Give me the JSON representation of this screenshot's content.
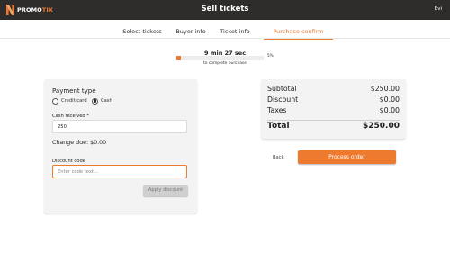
{
  "header": {
    "logo_text_left": "PROMO",
    "logo_text_right": "TIX",
    "title": "Sell tickets",
    "user": "Evi"
  },
  "tabs": [
    {
      "label": "Select tickets",
      "active": false
    },
    {
      "label": "Buyer info",
      "active": false
    },
    {
      "label": "Ticket info",
      "active": false
    },
    {
      "label": "Purchase confirm",
      "active": true
    }
  ],
  "timer": {
    "text": "9 min 27 sec",
    "progress_percent": 5,
    "progress_label": "5%",
    "caption": "to complete purchase"
  },
  "payment": {
    "heading": "Payment type",
    "options": [
      {
        "label": "Credit card",
        "selected": false
      },
      {
        "label": "Cash",
        "selected": true
      }
    ],
    "cash_label": "Cash received *",
    "cash_value": "250",
    "change_due": "Change due: $0.00",
    "discount_label": "Discount code",
    "discount_placeholder": "Enter code text...",
    "apply_label": "Apply discount"
  },
  "summary": {
    "rows": [
      {
        "label": "Subtotal",
        "value": "$250.00"
      },
      {
        "label": "Discount",
        "value": "$0.00"
      },
      {
        "label": "Taxes",
        "value": "$0.00"
      }
    ],
    "total_label": "Total",
    "total_value": "$250.00"
  },
  "actions": {
    "back_label": "Back",
    "process_label": "Process order"
  },
  "colors": {
    "accent": "#ee7a2f",
    "header_bg": "#2e2d2c",
    "card_bg": "#f3f3f3"
  }
}
